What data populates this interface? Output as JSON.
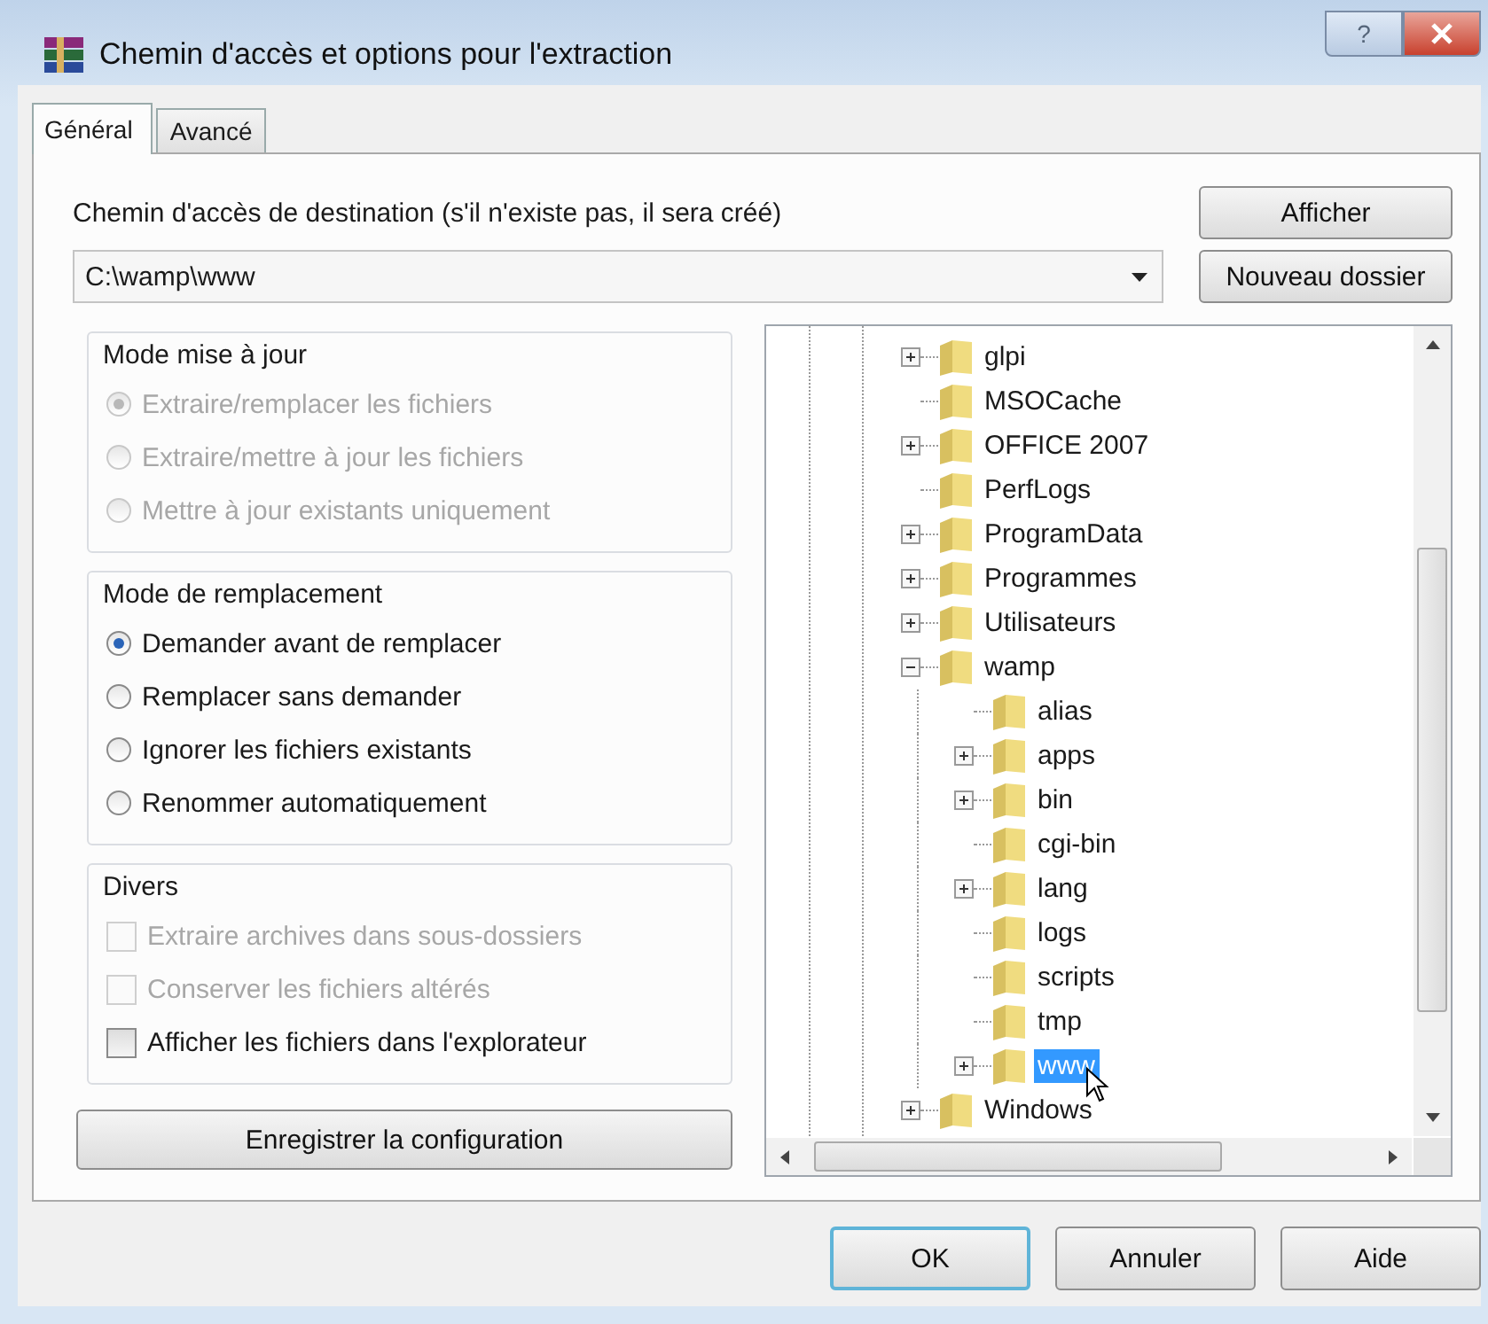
{
  "window": {
    "title": "Chemin d'accès et options pour l'extraction",
    "help_button": "?"
  },
  "tabs": [
    {
      "label": "Général",
      "selected": true
    },
    {
      "label": "Avancé",
      "selected": false
    }
  ],
  "destination": {
    "label": "Chemin d'accès de destination (s'il n'existe pas, il sera créé)",
    "value": "C:\\wamp\\www"
  },
  "side_buttons": [
    "Afficher",
    "Nouveau dossier"
  ],
  "groups": [
    {
      "title": "Mode mise à jour",
      "kind": "radio",
      "disabled": true,
      "options": [
        {
          "label": "Extraire/remplacer les fichiers",
          "selected": true
        },
        {
          "label": "Extraire/mettre à jour les fichiers",
          "selected": false
        },
        {
          "label": "Mettre à jour existants uniquement",
          "selected": false
        }
      ]
    },
    {
      "title": "Mode de remplacement",
      "kind": "radio",
      "disabled": false,
      "options": [
        {
          "label": "Demander avant de remplacer",
          "selected": true
        },
        {
          "label": "Remplacer sans demander",
          "selected": false
        },
        {
          "label": "Ignorer les fichiers existants",
          "selected": false
        },
        {
          "label": "Renommer automatiquement",
          "selected": false
        }
      ]
    },
    {
      "title": "Divers",
      "kind": "checkbox",
      "options": [
        {
          "label": "Extraire archives dans sous-dossiers",
          "checked": false,
          "disabled": true
        },
        {
          "label": "Conserver les fichiers altérés",
          "checked": false,
          "disabled": true
        },
        {
          "label": "Afficher les fichiers dans l'explorateur",
          "checked": false,
          "disabled": false
        }
      ]
    }
  ],
  "save_button": "Enregistrer la configuration",
  "tree": {
    "items": [
      {
        "name": "glpi",
        "expanded": false,
        "selected": false
      },
      {
        "name": "MSOCache",
        "selected": false
      },
      {
        "name": "OFFICE 2007",
        "expanded": false,
        "selected": false
      },
      {
        "name": "PerfLogs",
        "selected": false
      },
      {
        "name": "ProgramData",
        "expanded": false,
        "selected": false
      },
      {
        "name": "Programmes",
        "expanded": false,
        "selected": false
      },
      {
        "name": "Utilisateurs",
        "expanded": false,
        "selected": false
      },
      {
        "name": "wamp",
        "expanded": true,
        "selected": false,
        "children": [
          {
            "name": "alias",
            "selected": false
          },
          {
            "name": "apps",
            "expanded": false,
            "selected": false
          },
          {
            "name": "bin",
            "expanded": false,
            "selected": false
          },
          {
            "name": "cgi-bin",
            "selected": false
          },
          {
            "name": "lang",
            "expanded": false,
            "selected": false
          },
          {
            "name": "logs",
            "selected": false
          },
          {
            "name": "scripts",
            "selected": false
          },
          {
            "name": "tmp",
            "selected": false
          },
          {
            "name": "www",
            "expanded": false,
            "selected": true
          }
        ]
      },
      {
        "name": "Windows",
        "expanded": false,
        "selected": false
      }
    ]
  },
  "dialog_buttons": [
    {
      "label": "OK",
      "kind": "default"
    },
    {
      "label": "Annuler",
      "kind": "normal"
    },
    {
      "label": "Aide",
      "kind": "normal"
    }
  ]
}
